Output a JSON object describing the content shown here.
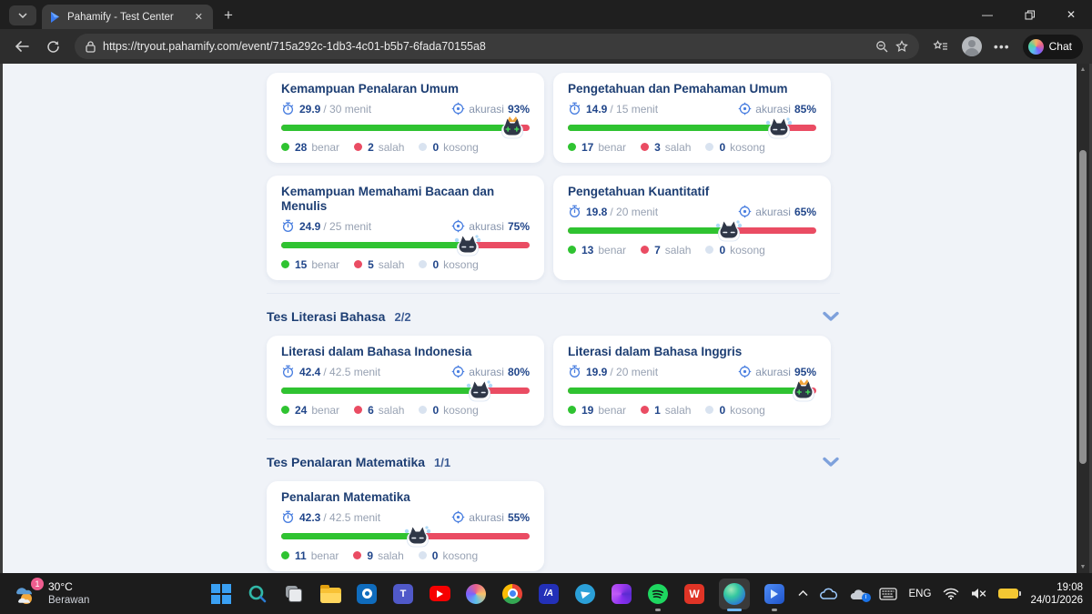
{
  "browser": {
    "tab_title": "Pahamify - Test Center",
    "url": "https://tryout.pahamify.com/event/715a292c-1db3-4c01-b5b7-6fada70155a8",
    "chat_label": "Chat"
  },
  "labels": {
    "accuracy": "akurasi",
    "benar": "benar",
    "salah": "salah",
    "kosong": "kosong"
  },
  "sections": [
    {
      "title": "Tes Literasi Bahasa",
      "count": "2/2"
    },
    {
      "title": "Tes Penalaran Matematika",
      "count": "1/1"
    }
  ],
  "cards": [
    {
      "title": "Kemampuan Penalaran Umum",
      "time_used": "29.9",
      "time_total": "/ 30 menit",
      "accuracy": "93%",
      "accuracy_pct": 93,
      "benar": 28,
      "salah": 2,
      "kosong": 0,
      "crown": true,
      "sweat": false
    },
    {
      "title": "Pengetahuan dan Pemahaman Umum",
      "time_used": "14.9",
      "time_total": "/ 15 menit",
      "accuracy": "85%",
      "accuracy_pct": 85,
      "benar": 17,
      "salah": 3,
      "kosong": 0,
      "crown": false,
      "sweat": true
    },
    {
      "title": "Kemampuan Memahami Bacaan dan Menulis",
      "time_used": "24.9",
      "time_total": "/ 25 menit",
      "accuracy": "75%",
      "accuracy_pct": 75,
      "benar": 15,
      "salah": 5,
      "kosong": 0,
      "crown": false,
      "sweat": true
    },
    {
      "title": "Pengetahuan Kuantitatif",
      "time_used": "19.8",
      "time_total": "/ 20 menit",
      "accuracy": "65%",
      "accuracy_pct": 65,
      "benar": 13,
      "salah": 7,
      "kosong": 0,
      "crown": false,
      "sweat": true
    },
    {
      "title": "Literasi dalam Bahasa Indonesia",
      "time_used": "42.4",
      "time_total": "/ 42.5 menit",
      "accuracy": "80%",
      "accuracy_pct": 80,
      "benar": 24,
      "salah": 6,
      "kosong": 0,
      "crown": false,
      "sweat": true
    },
    {
      "title": "Literasi dalam Bahasa Inggris",
      "time_used": "19.9",
      "time_total": "/ 20 menit",
      "accuracy": "95%",
      "accuracy_pct": 95,
      "benar": 19,
      "salah": 1,
      "kosong": 0,
      "crown": true,
      "sweat": false
    },
    {
      "title": "Penalaran Matematika",
      "time_used": "42.3",
      "time_total": "/ 42.5 menit",
      "accuracy": "55%",
      "accuracy_pct": 55,
      "benar": 11,
      "salah": 9,
      "kosong": 0,
      "crown": false,
      "sweat": true
    }
  ],
  "taskbar": {
    "weather": {
      "temp": "30°C",
      "desc": "Berawan",
      "badge": "1"
    },
    "apps": [
      "start",
      "search",
      "task-view",
      "file-explorer",
      "outlook",
      "teams",
      "youtube",
      "copilot",
      "chrome",
      "ia-app",
      "telegram",
      "microsoft-365",
      "spotify",
      "wps-office",
      "edge",
      "pahamify"
    ],
    "icon_glyphs": {
      "teams": "T",
      "ia_app": "/A",
      "wps": "W"
    },
    "tray": {
      "language": "ENG",
      "time": "19:08",
      "date": "24/01/2026"
    }
  }
}
